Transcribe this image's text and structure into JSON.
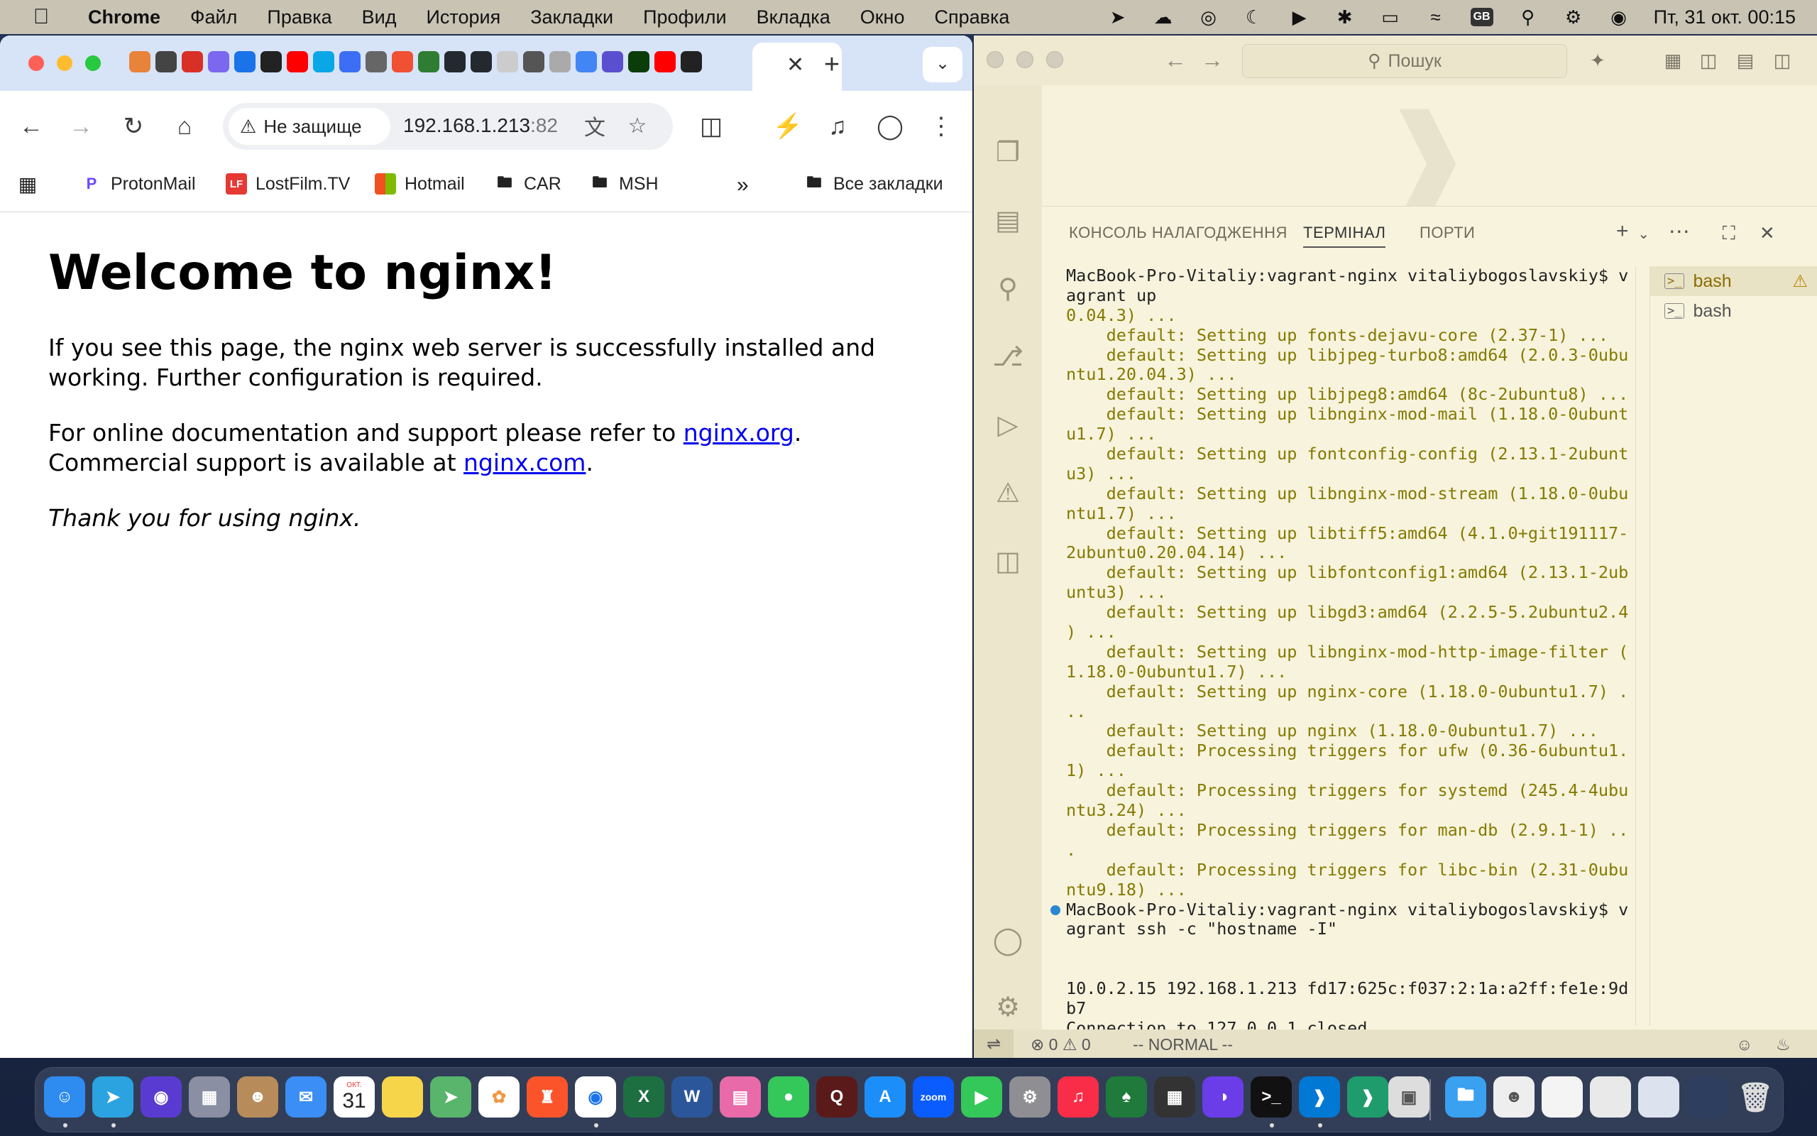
{
  "menubar": {
    "app_name": "Chrome",
    "menus": [
      "Файл",
      "Правка",
      "Вид",
      "История",
      "Закладки",
      "Профили",
      "Вкладка",
      "Окно",
      "Справка"
    ],
    "keyboard_layout": "GB",
    "datetime": "Пт, 31 окт.  00:15"
  },
  "chrome": {
    "security_label": "Не защище",
    "url_host": "192.168.1.213",
    "url_port": ":82",
    "bookmarks": [
      {
        "label": "ProtonMail",
        "icon": "protonmail-icon"
      },
      {
        "label": "LostFilm.TV",
        "icon": "lostfilm-icon"
      },
      {
        "label": "Hotmail",
        "icon": "microsoft-icon"
      },
      {
        "label": "CAR",
        "icon": "folder-icon"
      },
      {
        "label": "MSH",
        "icon": "folder-icon"
      }
    ],
    "all_bookmarks": "Все закладки",
    "page": {
      "heading": "Welcome to nginx!",
      "p1": "If you see this page, the nginx web server is successfully installed and working. Further configuration is required.",
      "p2_prefix": "For online documentation and support please refer to ",
      "link1": "nginx.org",
      "p2_mid": ".",
      "p2_line2": "Commercial support is available at ",
      "link2": "nginx.com",
      "p2_end": ".",
      "p3": "Thank you for using nginx."
    }
  },
  "vscode": {
    "search_placeholder": "Пошук",
    "panel_tabs": [
      "КОНСОЛЬ НАЛАГОДЖЕННЯ",
      "ТЕРМІНАЛ",
      "ПОРТИ"
    ],
    "terminal_lines": [
      {
        "text": "MacBook-Pro-Vitaliy:vagrant-nginx vitaliybogoslavskiy$ v",
        "kind": "cmd"
      },
      {
        "text": "agrant up",
        "kind": "cmd"
      },
      {
        "text": "0.04.3) ...",
        "kind": "out"
      },
      {
        "text": "    default: Setting up fonts-dejavu-core (2.37-1) ...",
        "kind": "out"
      },
      {
        "text": "    default: Setting up libjpeg-turbo8:amd64 (2.0.3-0ubu",
        "kind": "out"
      },
      {
        "text": "ntu1.20.04.3) ...",
        "kind": "out"
      },
      {
        "text": "    default: Setting up libjpeg8:amd64 (8c-2ubuntu8) ...",
        "kind": "out"
      },
      {
        "text": "    default: Setting up libnginx-mod-mail (1.18.0-0ubunt",
        "kind": "out"
      },
      {
        "text": "u1.7) ...",
        "kind": "out"
      },
      {
        "text": "    default: Setting up fontconfig-config (2.13.1-2ubunt",
        "kind": "out"
      },
      {
        "text": "u3) ...",
        "kind": "out"
      },
      {
        "text": "    default: Setting up libnginx-mod-stream (1.18.0-0ubu",
        "kind": "out"
      },
      {
        "text": "ntu1.7) ...",
        "kind": "out"
      },
      {
        "text": "    default: Setting up libtiff5:amd64 (4.1.0+git191117-",
        "kind": "out"
      },
      {
        "text": "2ubuntu0.20.04.14) ...",
        "kind": "out"
      },
      {
        "text": "    default: Setting up libfontconfig1:amd64 (2.13.1-2ub",
        "kind": "out"
      },
      {
        "text": "untu3) ...",
        "kind": "out"
      },
      {
        "text": "    default: Setting up libgd3:amd64 (2.2.5-5.2ubuntu2.4",
        "kind": "out"
      },
      {
        "text": ") ...",
        "kind": "out"
      },
      {
        "text": "    default: Setting up libnginx-mod-http-image-filter (",
        "kind": "out"
      },
      {
        "text": "1.18.0-0ubuntu1.7) ...",
        "kind": "out"
      },
      {
        "text": "    default: Setting up nginx-core (1.18.0-0ubuntu1.7) .",
        "kind": "out"
      },
      {
        "text": "..",
        "kind": "out"
      },
      {
        "text": "    default: Setting up nginx (1.18.0-0ubuntu1.7) ...",
        "kind": "out"
      },
      {
        "text": "    default: Processing triggers for ufw (0.36-6ubuntu1.",
        "kind": "out"
      },
      {
        "text": "1) ...",
        "kind": "out"
      },
      {
        "text": "    default: Processing triggers for systemd (245.4-4ubu",
        "kind": "out"
      },
      {
        "text": "ntu3.24) ...",
        "kind": "out"
      },
      {
        "text": "    default: Processing triggers for man-db (2.9.1-1) ..",
        "kind": "out"
      },
      {
        "text": ".",
        "kind": "out"
      },
      {
        "text": "    default: Processing triggers for libc-bin (2.31-0ubu",
        "kind": "out"
      },
      {
        "text": "ntu9.18) ...",
        "kind": "out"
      },
      {
        "text": "MacBook-Pro-Vitaliy:vagrant-nginx vitaliybogoslavskiy$ v",
        "kind": "cmd",
        "marker": "filled"
      },
      {
        "text": "agrant ssh -c \"hostname -I\"",
        "kind": "cmd"
      },
      {
        "text": "",
        "kind": "cmd"
      },
      {
        "text": "",
        "kind": "cmd"
      },
      {
        "text": "10.0.2.15 192.168.1.213 fd17:625c:f037:2:1a:a2ff:fe1e:9d",
        "kind": "cmd"
      },
      {
        "text": "b7",
        "kind": "cmd"
      },
      {
        "text": "Connection to 127.0.0.1 closed.",
        "kind": "cmd"
      },
      {
        "text": "MacBook-Pro-Vitaliy:vagrant-nginx vitaliybogoslavskiy$ ",
        "kind": "cmd",
        "marker": "hollow",
        "cursor": true
      }
    ],
    "terminal_instances": [
      {
        "label": "bash",
        "warning": true
      },
      {
        "label": "bash",
        "warning": false
      }
    ],
    "status": {
      "errors": "0",
      "warnings": "0",
      "vim_mode": "-- NORMAL --"
    }
  },
  "dock_apps": [
    "Finder",
    "Telegram",
    "Siri",
    "Launchpad",
    "Contacts",
    "Mail",
    "Calendar",
    "Notes",
    "Maps",
    "Photos",
    "Brave",
    "Chrome",
    "Excel",
    "Word",
    "Keynote",
    "Messages",
    "Quake",
    "App Store",
    "Zoom",
    "FaceTime",
    "System Settings",
    "Music",
    "Solitaire",
    "Calculator",
    "Arc",
    "Terminal",
    "VS Code",
    "VS Code Insiders",
    "Preview",
    "Downloads",
    "Trash"
  ],
  "calendar_day": "31",
  "calendar_month": "ОКТ.",
  "zoom_label": "zoom"
}
